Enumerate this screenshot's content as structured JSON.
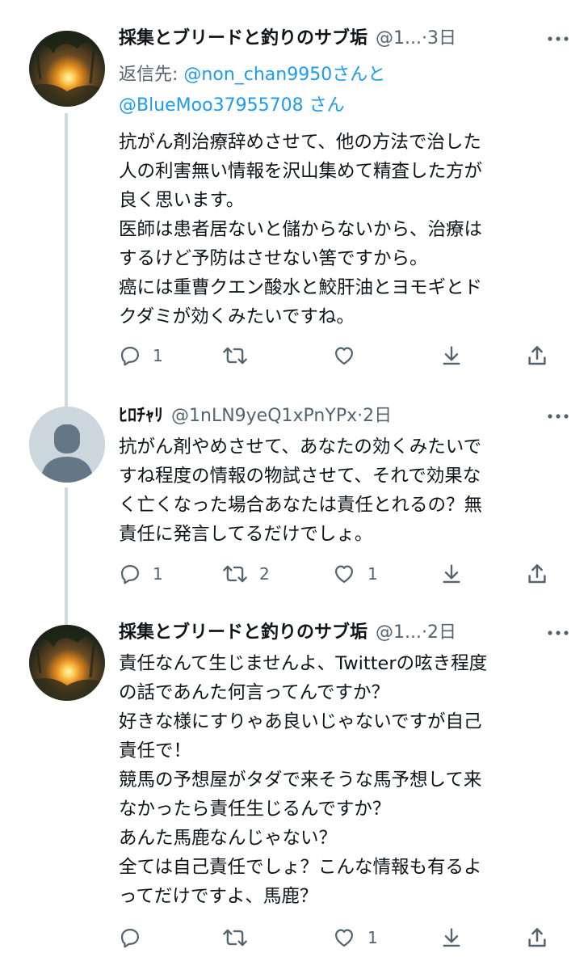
{
  "tweets": [
    {
      "name": "採集とブリードと釣りのサブ垢",
      "handle": "@1...",
      "dot": "·",
      "time": "3日",
      "reply_label": "返信先:",
      "reply_mention_1": "@non_chan9950",
      "reply_and": "さんと",
      "reply_mention_2": "@BlueMoo37955708",
      "reply_san": "さん",
      "lines": [
        "抗がん剤治療辞めさせて、他の方法で治した",
        "人の利害無い情報を沢山集めて精査した方が",
        "良く思います。",
        "医師は患者居ないと儲からないから、治療は",
        "するけど予防はさせない筈ですから。",
        "癌には重曹クエン酸水と鮫肝油とヨモギとド",
        "クダミが効くみたいですね。"
      ],
      "reply_count": "1",
      "retweet_count": "",
      "like_count": "",
      "avatar": "sunset-photo"
    },
    {
      "name": "ﾋﾛﾁｬﾘ",
      "handle": "@1nLN9yeQ1xPnYPx",
      "dot": "·",
      "time": "2日",
      "lines": [
        "抗がん剤やめさせて、あなたの効くみたいで",
        "すね程度の情報の物試させて、それで効果な",
        "く亡くなった場合あなたは責任とれるの？無",
        "責任に発言してるだけでしょ。"
      ],
      "reply_count": "1",
      "retweet_count": "2",
      "like_count": "1",
      "avatar": "default-profile"
    },
    {
      "name": "採集とブリードと釣りのサブ垢",
      "handle": "@1...",
      "dot": "·",
      "time": "2日",
      "lines": [
        "責任なんて生じませんよ、Twitterの呟き程度",
        "の話であんた何言ってんですか？",
        "好きな様にすりゃあ良いじゃないですが自己",
        "責任で！",
        "競馬の予想屋がタダで来そうな馬予想して来",
        "なかったら責任生じるんですか？",
        "あんた馬鹿なんじゃない？",
        "全ては自己責任でしょ？こんな情報も有るよ",
        "ってだけですよ、馬鹿？"
      ],
      "reply_count": "",
      "retweet_count": "",
      "like_count": "1",
      "avatar": "sunset-photo"
    }
  ],
  "icons": {
    "reply": "reply-icon",
    "retweet": "retweet-icon",
    "like": "heart-icon",
    "download": "download-icon",
    "share": "share-icon",
    "more": "more-icon"
  },
  "colors": {
    "text": "#0f1419",
    "secondary": "#536471",
    "link": "#1d9bf0",
    "thread_line": "#cfd9de"
  }
}
